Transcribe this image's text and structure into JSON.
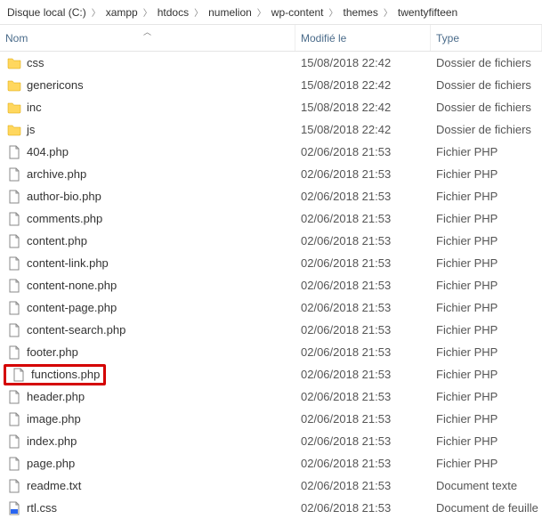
{
  "breadcrumb": [
    "Disque local (C:)",
    "xampp",
    "htdocs",
    "numelion",
    "wp-content",
    "themes",
    "twentyfifteen"
  ],
  "columns": {
    "name": "Nom",
    "modified": "Modifié le",
    "type": "Type"
  },
  "files": [
    {
      "icon": "folder",
      "name": "css",
      "date": "15/08/2018 22:42",
      "type": "Dossier de fichiers",
      "hl": false
    },
    {
      "icon": "folder",
      "name": "genericons",
      "date": "15/08/2018 22:42",
      "type": "Dossier de fichiers",
      "hl": false
    },
    {
      "icon": "folder",
      "name": "inc",
      "date": "15/08/2018 22:42",
      "type": "Dossier de fichiers",
      "hl": false
    },
    {
      "icon": "folder",
      "name": "js",
      "date": "15/08/2018 22:42",
      "type": "Dossier de fichiers",
      "hl": false
    },
    {
      "icon": "php",
      "name": "404.php",
      "date": "02/06/2018 21:53",
      "type": "Fichier PHP",
      "hl": false
    },
    {
      "icon": "php",
      "name": "archive.php",
      "date": "02/06/2018 21:53",
      "type": "Fichier PHP",
      "hl": false
    },
    {
      "icon": "php",
      "name": "author-bio.php",
      "date": "02/06/2018 21:53",
      "type": "Fichier PHP",
      "hl": false
    },
    {
      "icon": "php",
      "name": "comments.php",
      "date": "02/06/2018 21:53",
      "type": "Fichier PHP",
      "hl": false
    },
    {
      "icon": "php",
      "name": "content.php",
      "date": "02/06/2018 21:53",
      "type": "Fichier PHP",
      "hl": false
    },
    {
      "icon": "php",
      "name": "content-link.php",
      "date": "02/06/2018 21:53",
      "type": "Fichier PHP",
      "hl": false
    },
    {
      "icon": "php",
      "name": "content-none.php",
      "date": "02/06/2018 21:53",
      "type": "Fichier PHP",
      "hl": false
    },
    {
      "icon": "php",
      "name": "content-page.php",
      "date": "02/06/2018 21:53",
      "type": "Fichier PHP",
      "hl": false
    },
    {
      "icon": "php",
      "name": "content-search.php",
      "date": "02/06/2018 21:53",
      "type": "Fichier PHP",
      "hl": false
    },
    {
      "icon": "php",
      "name": "footer.php",
      "date": "02/06/2018 21:53",
      "type": "Fichier PHP",
      "hl": false
    },
    {
      "icon": "php",
      "name": "functions.php",
      "date": "02/06/2018 21:53",
      "type": "Fichier PHP",
      "hl": true
    },
    {
      "icon": "php",
      "name": "header.php",
      "date": "02/06/2018 21:53",
      "type": "Fichier PHP",
      "hl": false
    },
    {
      "icon": "php",
      "name": "image.php",
      "date": "02/06/2018 21:53",
      "type": "Fichier PHP",
      "hl": false
    },
    {
      "icon": "php",
      "name": "index.php",
      "date": "02/06/2018 21:53",
      "type": "Fichier PHP",
      "hl": false
    },
    {
      "icon": "php",
      "name": "page.php",
      "date": "02/06/2018 21:53",
      "type": "Fichier PHP",
      "hl": false
    },
    {
      "icon": "txt",
      "name": "readme.txt",
      "date": "02/06/2018 21:53",
      "type": "Document texte",
      "hl": false
    },
    {
      "icon": "css",
      "name": "rtl.css",
      "date": "02/06/2018 21:53",
      "type": "Document de feuille",
      "hl": false
    }
  ]
}
